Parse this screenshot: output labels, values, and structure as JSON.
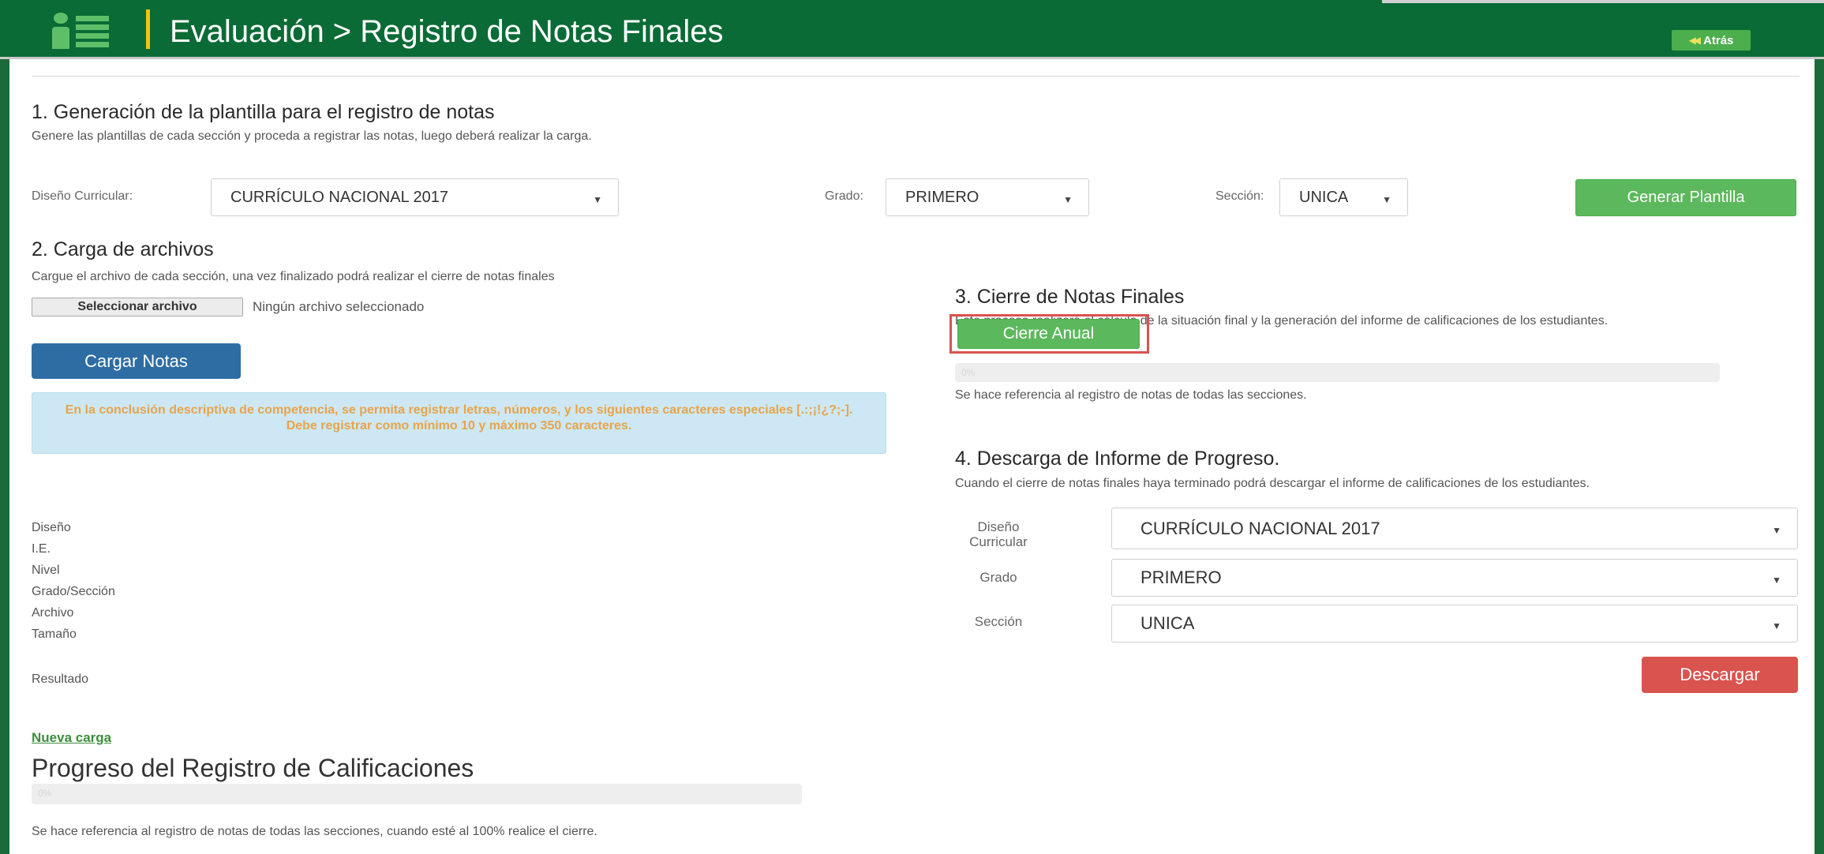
{
  "header": {
    "title": "Evaluación > Registro de Notas Finales",
    "back_label": "Atrás",
    "back_icon": "double-left-arrow-icon",
    "logo_icon": "user-list-icon"
  },
  "section1": {
    "title": "1. Generación de la plantilla para el registro de notas",
    "description": "Genere las plantillas de cada sección y proceda a registrar las notas, luego deberá realizar la carga.",
    "diseno_label": "Diseño Curricular:",
    "diseno_value": "CURRÍCULO NACIONAL 2017",
    "grado_label": "Grado:",
    "grado_value": "PRIMERO",
    "seccion_label": "Sección:",
    "seccion_value": "UNICA",
    "generate_button": "Generar Plantilla"
  },
  "section2": {
    "title": "2. Carga de archivos",
    "description": "Cargue el archivo de cada sección, una vez finalizado podrá realizar el cierre de notas finales",
    "file_button": "Seleccionar archivo",
    "file_status": "Ningún archivo seleccionado",
    "upload_button": "Cargar Notas",
    "info_text": "En la conclusión descriptiva de competencia, se permita registrar letras, números, y los siguientes caracteres especiales [.:;¡!¿?;-]. Debe registrar como mínimo 10 y máximo 350 caracteres.",
    "fields": [
      "Diseño",
      "I.E.",
      "Nivel",
      "Grado/Sección",
      "Archivo",
      "Tamaño"
    ],
    "result_label": "Resultado",
    "new_upload_link": "Nueva carga"
  },
  "section3": {
    "title": "3. Cierre de Notas Finales",
    "description": "Este proceso realizará el cálculo de la situación final y la generación del informe de calificaciones de los estudiantes.",
    "close_button": "Cierre Anual",
    "progress_text": "0%",
    "progress_value": 0,
    "note": "Se hace referencia al registro de notas de todas las secciones."
  },
  "section4": {
    "title": "4. Descarga de Informe de Progreso.",
    "description": "Cuando el cierre de notas finales haya terminado podrá descargar el informe de calificaciones de los estudiantes.",
    "diseno_label": "Diseño Curricular",
    "diseno_value": "CURRÍCULO NACIONAL 2017",
    "grado_label": "Grado",
    "grado_value": "PRIMERO",
    "seccion_label": "Sección",
    "seccion_value": "UNICA",
    "download_button": "Descargar"
  },
  "progress_section": {
    "title": "Progreso del Registro de Calificaciones",
    "progress_text": "0%",
    "progress_value": 0,
    "note": "Se hace referencia al registro de notas de todas las secciones, cuando esté al 100% realice el cierre."
  },
  "colors": {
    "header_bg": "#0b6b36",
    "accent_green": "#5cb85c",
    "primary_blue": "#2e6da4",
    "danger_red": "#d9534f",
    "info_bg": "#cde8f4",
    "info_text": "#e8a44a",
    "separator_yellow": "#f1c40f"
  }
}
